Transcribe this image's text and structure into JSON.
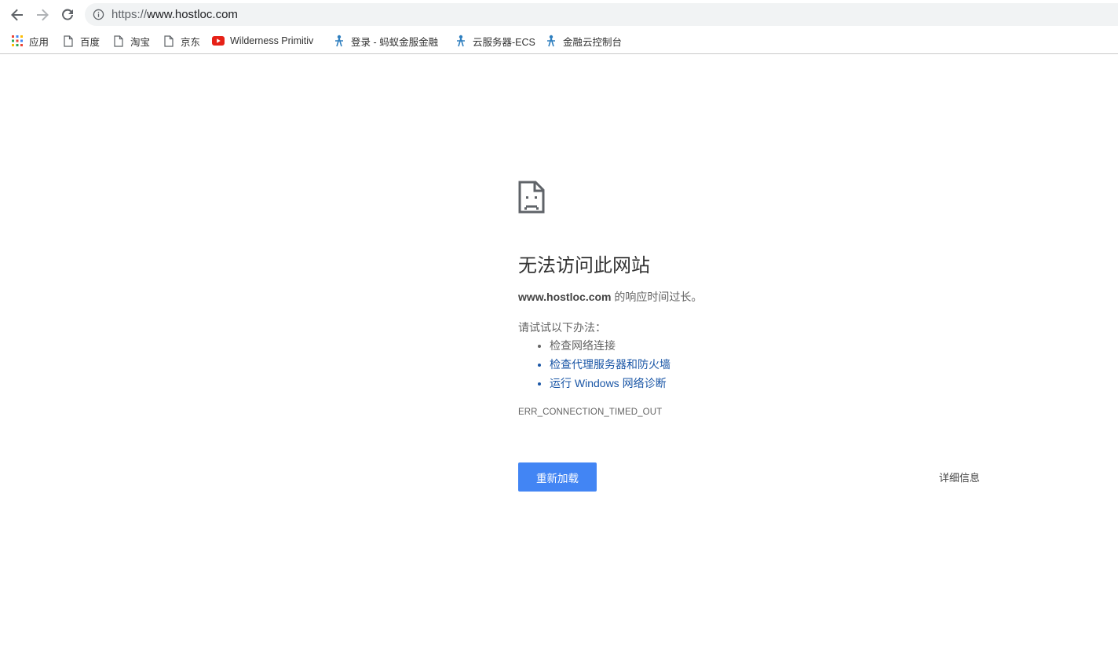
{
  "toolbar": {
    "url_scheme": "https://",
    "url_host": "www.hostloc.com"
  },
  "bookmarks": [
    {
      "label": "应用",
      "icon": "apps-grid-icon"
    },
    {
      "label": "百度",
      "icon": "page-icon"
    },
    {
      "label": "淘宝",
      "icon": "page-icon"
    },
    {
      "label": "京东",
      "icon": "page-icon"
    },
    {
      "label": "Wilderness Primitiv",
      "icon": "youtube-icon"
    },
    {
      "label": "登录 - 蚂蚁金服金融",
      "icon": "antfin-icon"
    },
    {
      "label": "云服务器-ECS",
      "icon": "antfin-icon"
    },
    {
      "label": "金融云控制台",
      "icon": "antfin-icon"
    }
  ],
  "error": {
    "title": "无法访问此网站",
    "host": "www.hostloc.com",
    "message_suffix": " 的响应时间过长。",
    "try_label": "请试试以下办法：",
    "suggestions": [
      "检查网络连接",
      "检查代理服务器和防火墙",
      "运行 Windows 网络诊断"
    ],
    "code": "ERR_CONNECTION_TIMED_OUT",
    "reload_label": "重新加载",
    "details_label": "详细信息"
  },
  "colors": {
    "accent": "#4285f4",
    "link": "#1a56a6",
    "omnibox_bg": "#f1f3f4"
  }
}
